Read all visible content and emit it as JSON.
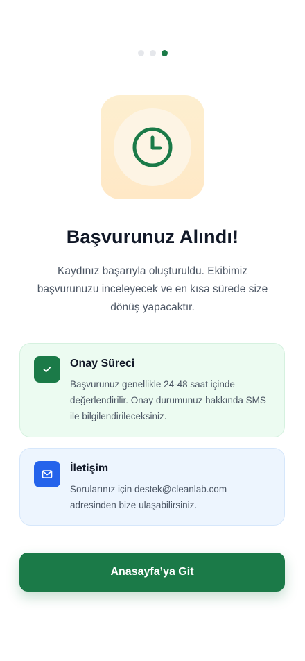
{
  "pager": {
    "count": 3,
    "active_index": 2
  },
  "hero": {
    "icon": "clock-icon"
  },
  "title": "Başvurunuz Alındı!",
  "subtitle": "Kaydınız başarıyla oluşturuldu. Ekibimiz başvurunuzu inceleyecek ve en kısa sürede size dönüş yapacaktır.",
  "cards": [
    {
      "icon": "check-icon",
      "title": "Onay Süreci",
      "text": "Başvurunuz genellikle 24-48 saat içinde değerlendirilir. Onay durumunuz hakkında SMS ile bilgilendirileceksiniz."
    },
    {
      "icon": "mail-icon",
      "title": "İletişim",
      "text": "Sorularınız için destek@cleanlab.com adresinden bize ulaşabilirsiniz."
    }
  ],
  "cta": {
    "label": "Anasayfa’ya Git"
  },
  "colors": {
    "primary": "#1b7a48",
    "info": "#2563eb",
    "hero_bg": "#fdefd0"
  }
}
